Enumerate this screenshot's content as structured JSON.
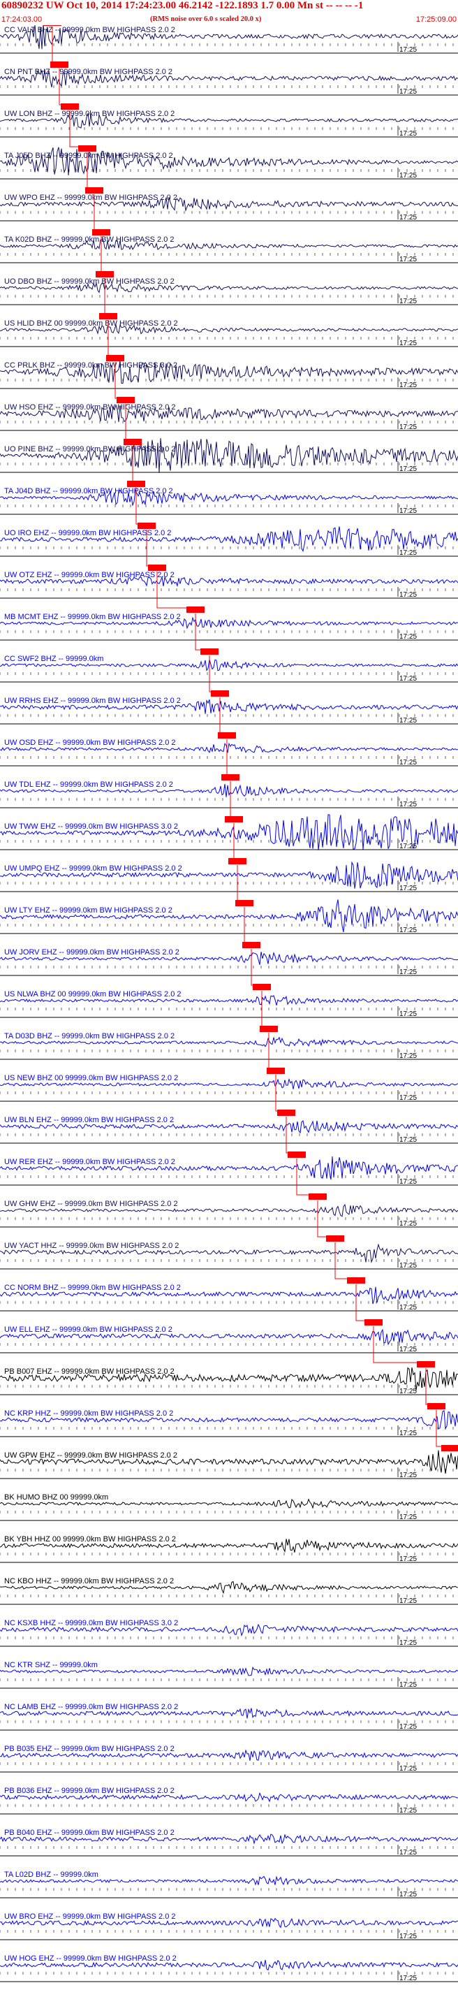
{
  "header": {
    "title": "60890232 UW Oct 10, 2014 17:24:23.00   46.2142 -122.1893  1.7 0.00 Mn st -- -- -- -1",
    "subtitle": "(RMS noise over 6.0 s scaled 20.0 x)",
    "start_time": "17:24:03.00",
    "end_time": "17:25:09.00"
  },
  "chart_data": {
    "type": "line",
    "title": "60890232 UW Oct 10, 2014 17:24:23.00   46.2142 -122.1893  1.7 0.00 Mn st -- -- -- -1",
    "x_range": [
      "17:24:03.00",
      "17:25:09.00"
    ],
    "x_tick_label": "17:25",
    "grid": false,
    "pick_color": "#ff0000",
    "colors": {
      "black": "#000000",
      "blue": "#0000ff",
      "navy": "#101060",
      "pick": "#ff0000"
    },
    "channels": [
      {
        "label": "CC VALT BHZ -- 99999.0km BW  HIGHPASS  2.0  2",
        "color": "navy"
      },
      {
        "label": "CN PNT BHZ -- 99999.0km BW  HIGHPASS  2.0  2",
        "color": "navy"
      },
      {
        "label": "UW LON BHZ -- 99999.0km BW  HIGHPASS  2.0  2",
        "color": "navy"
      },
      {
        "label": "TA J05D BHZ -- 99999.0km BW  HIGHPASS  2.0  2",
        "color": "navy"
      },
      {
        "label": "UW WPO EHZ -- 99999.0km BW  HIGHPASS  2.0  2",
        "color": "navy"
      },
      {
        "label": "TA K02D BHZ -- 99999.0km BW  HIGHPASS  2.0  2",
        "color": "navy"
      },
      {
        "label": "UO DBO BHZ -- 99999.0km BW  HIGHPASS  2.0  2",
        "color": "navy"
      },
      {
        "label": "US HLID BHZ 00 99999.0km BW  HIGHPASS  2.0  2",
        "color": "navy"
      },
      {
        "label": "CC PRLK BHZ -- 99999.0km BW  HIGHPASS  3.0  2",
        "color": "navy"
      },
      {
        "label": "UW HSO EHZ -- 99999.0km BW  HIGHPASS  2.0  2",
        "color": "navy"
      },
      {
        "label": "UO PINE BHZ -- 99999.0km BW  HIGHPASS  2.0  2",
        "color": "navy"
      },
      {
        "label": "TA J04D BHZ -- 99999.0km BW  HIGHPASS  2.0  2",
        "color": "blue"
      },
      {
        "label": "UO IRO EHZ -- 99999.0km BW  HIGHPASS  2.0  2",
        "color": "blue"
      },
      {
        "label": "UW OTZ EHZ -- 99999.0km BW  HIGHPASS  2.0  2",
        "color": "blue"
      },
      {
        "label": "MB MCMT EHZ -- 99999.0km BW  HIGHPASS  2.0  2",
        "color": "blue"
      },
      {
        "label": "CC SWF2 BHZ -- 99999.0km",
        "color": "blue"
      },
      {
        "label": "UW RRHS EHZ -- 99999.0km BW  HIGHPASS  2.0  2",
        "color": "blue"
      },
      {
        "label": "UW OSD EHZ -- 99999.0km BW  HIGHPASS  2.0  2",
        "color": "blue"
      },
      {
        "label": "UW TDL EHZ -- 99999.0km BW  HIGHPASS  2.0  2",
        "color": "blue"
      },
      {
        "label": "UW TWW EHZ -- 99999.0km BW  HIGHPASS  3.0  2",
        "color": "blue"
      },
      {
        "label": "UW UMPQ EHZ -- 99999.0km BW  HIGHPASS  2.0  2",
        "color": "blue"
      },
      {
        "label": "UW LTY EHZ -- 99999.0km BW  HIGHPASS  2.0  2",
        "color": "blue"
      },
      {
        "label": "UW JORV EHZ -- 99999.0km BW  HIGHPASS  2.0  2",
        "color": "blue"
      },
      {
        "label": "US NLWA BHZ 00 99999.0km BW  HIGHPASS  2.0  2",
        "color": "blue"
      },
      {
        "label": "TA D03D BHZ -- 99999.0km BW  HIGHPASS  2.0  2",
        "color": "blue"
      },
      {
        "label": "US NEW BHZ 00 99999.0km BW  HIGHPASS  2.0  2",
        "color": "blue"
      },
      {
        "label": "UW BLN EHZ -- 99999.0km BW  HIGHPASS  2.0  2",
        "color": "blue"
      },
      {
        "label": "UW RER EHZ -- 99999.0km BW  HIGHPASS  2.0  2",
        "color": "blue"
      },
      {
        "label": "UW GHW EHZ -- 99999.0km BW  HIGHPASS  2.0  2",
        "color": "navy"
      },
      {
        "label": "UW YACT HHZ -- 99999.0km BW  HIGHPASS  2.0  2",
        "color": "navy"
      },
      {
        "label": "CC NORM BHZ -- 99999.0km BW  HIGHPASS  2.0  2",
        "color": "blue"
      },
      {
        "label": "UW ELL EHZ -- 99999.0km BW  HIGHPASS  2.0  2",
        "color": "blue"
      },
      {
        "label": "PB B007 EHZ -- 99999.0km BW  HIGHPASS  2.0  2",
        "color": "black"
      },
      {
        "label": "NC KRP HHZ -- 99999.0km BW  HIGHPASS  2.0  2",
        "color": "blue"
      },
      {
        "label": "UW GPW EHZ -- 99999.0km BW  HIGHPASS  2.0  2",
        "color": "black"
      },
      {
        "label": "BK HUMO BHZ 00 99999.0km",
        "color": "black"
      },
      {
        "label": "BK YBH HHZ 00 99999.0km BW  HIGHPASS  2.0  2",
        "color": "black"
      },
      {
        "label": "NC KBO HHZ -- 99999.0km BW  HIGHPASS  2.0  2",
        "color": "black"
      },
      {
        "label": "NC KSXB HHZ -- 99999.0km BW  HIGHPASS  3.0  2",
        "color": "blue"
      },
      {
        "label": "NC KTR SHZ -- 99999.0km",
        "color": "blue"
      },
      {
        "label": "NC LAMB EHZ -- 99999.0km BW  HIGHPASS  2.0  2",
        "color": "blue"
      },
      {
        "label": "PB B035 EHZ -- 99999.0km BW  HIGHPASS  2.0  2",
        "color": "blue"
      },
      {
        "label": "PB B036 EHZ -- 99999.0km BW  HIGHPASS  2.0  2",
        "color": "blue"
      },
      {
        "label": "PB B040 EHZ -- 99999.0km BW  HIGHPASS  2.0  2",
        "color": "blue"
      },
      {
        "label": "TA L02D BHZ -- 99999.0km",
        "color": "blue"
      },
      {
        "label": "UW BRO EHZ -- 99999.0km BW  HIGHPASS  2.0  2",
        "color": "blue"
      },
      {
        "label": "UW HOG EHZ -- 99999.0km BW  HIGHPASS  2.0  2",
        "color": "blue"
      }
    ]
  }
}
